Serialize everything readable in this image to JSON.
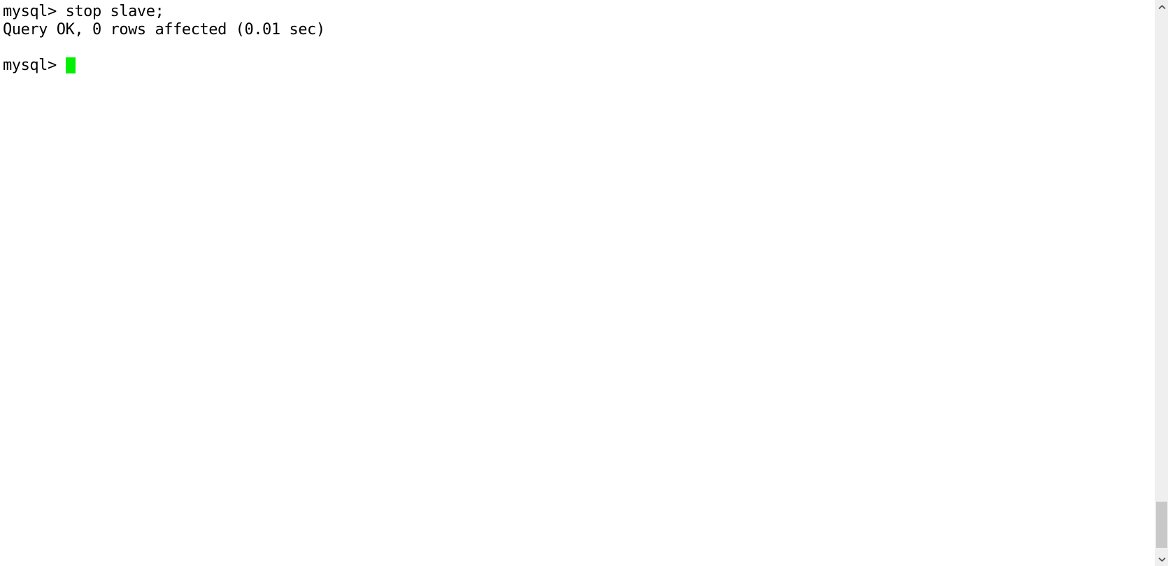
{
  "terminal": {
    "app": "mysql-client",
    "background_color": "#ffffff",
    "text_color": "#000000",
    "cursor_color": "#00f000",
    "lines": [
      {
        "type": "command",
        "text": "mysql> stop slave;"
      },
      {
        "type": "output",
        "text": "Query OK, 0 rows affected (0.01 sec)"
      },
      {
        "type": "blank",
        "text": " "
      }
    ],
    "prompt": {
      "text": "mysql> ",
      "cursor": "block-cursor"
    }
  },
  "scrollbar": {
    "track_color": "#efefef",
    "thumb_color": "#c8c8c8",
    "up_arrow": "chevron-up-icon",
    "down_arrow": "chevron-down-icon"
  }
}
